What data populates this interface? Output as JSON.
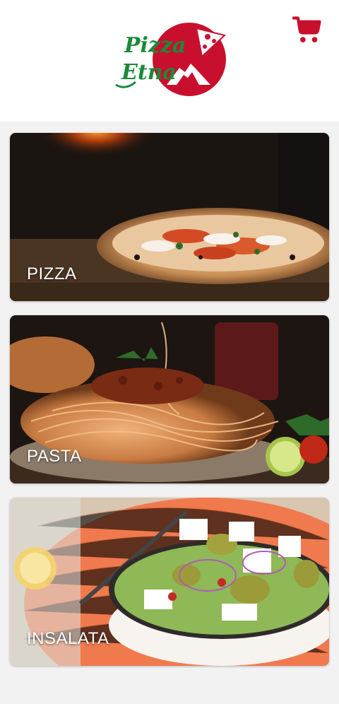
{
  "header": {
    "logo_line1": "Pizza",
    "logo_line2": "Etna",
    "cart_icon": "shopping-cart-icon",
    "brand_green": "#1a8a3a",
    "brand_red": "#c8102e"
  },
  "categories": [
    {
      "label": "PIZZA",
      "image": "pizza-photo"
    },
    {
      "label": "PASTA",
      "image": "pasta-photo"
    },
    {
      "label": "INSALATA",
      "image": "salad-photo"
    }
  ]
}
